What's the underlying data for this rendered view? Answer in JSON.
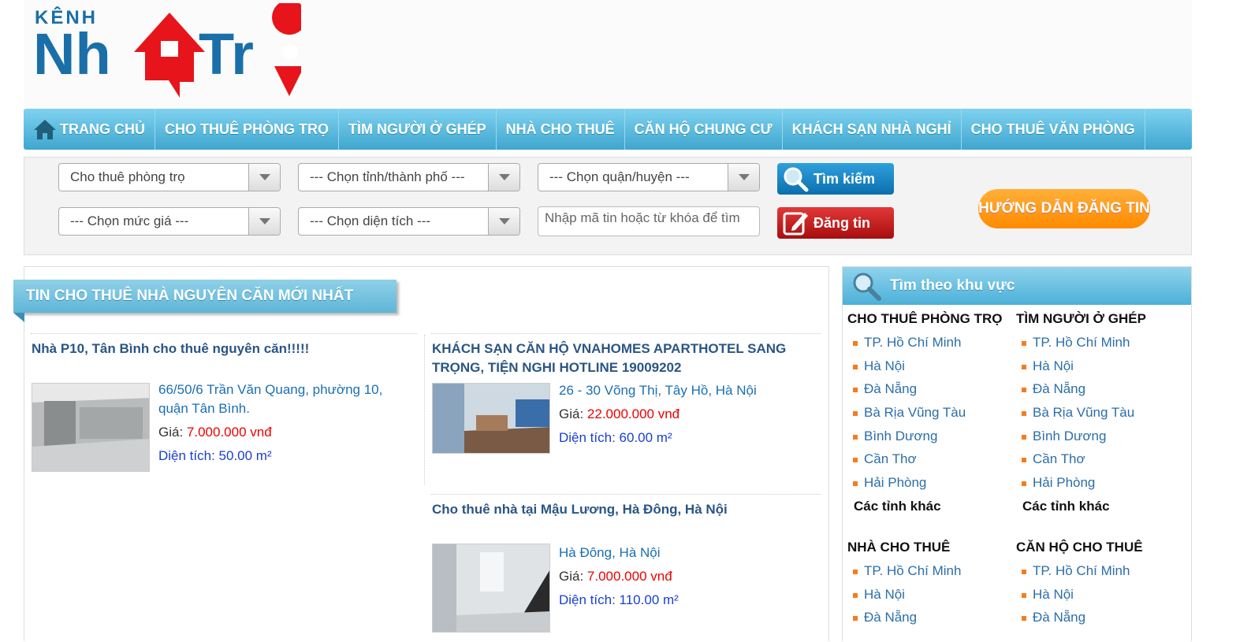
{
  "logo": {
    "top_text": "KÊNH",
    "main_text": "Nhà Trọ"
  },
  "nav": {
    "home": "TRANG CHỦ",
    "items": [
      "CHO THUÊ PHÒNG TRỌ",
      "TÌM NGƯỜI Ở GHÉP",
      "NHÀ CHO THUÊ",
      "CĂN HỘ CHUNG CƯ",
      "KHÁCH SẠN NHÀ NGHỈ",
      "CHO THUÊ VĂN PHÒNG"
    ]
  },
  "search": {
    "category": "Cho thuê phòng trọ",
    "province": "--- Chọn tỉnh/thành phố ---",
    "district": "--- Chọn quận/huyện ---",
    "price": "--- Chọn mức giá ---",
    "area": "--- Chọn diện tích ---",
    "keyword_placeholder": "Nhập mã tin hoặc từ khóa để tìm",
    "search_btn": "Tìm kiếm",
    "post_btn": "Đăng tin",
    "guide_btn": "HƯỚNG DẪN ĐĂNG TIN"
  },
  "main": {
    "section_title": "TIN CHO THUÊ NHÀ NGUYÊN CĂN MỚI NHẤT",
    "listings": [
      {
        "title": "Nhà P10, Tân Bình cho thuê nguyên căn!!!!!",
        "address": "66/50/6 Trần Văn Quang, phường 10, quận Tân Bình.",
        "price_label": "Giá:",
        "price": "7.000.000 vnđ",
        "area": "Diện tích: 50.00 m²"
      },
      {
        "title": "KHÁCH SẠN CĂN HỘ VNAHOMES APARTHOTEL SANG TRỌNG, TIỆN NGHI HOTLINE 19009202",
        "address": "26 - 30 Võng Thị, Tây Hồ, Hà Nội",
        "price_label": "Giá:",
        "price": "22.000.000 vnđ",
        "area": "Diện tích: 60.00 m²"
      },
      {
        "title": "Cho thuê nhà tại Mậu Lương, Hà Đông, Hà Nội",
        "address": "Hà Đông, Hà Nội",
        "price_label": "Giá:",
        "price": "7.000.000 vnđ",
        "area": "Diện tích: 110.00 m²"
      }
    ]
  },
  "sidebar": {
    "title": "Tìm theo khu vực",
    "groups": [
      {
        "heading": "CHO THUÊ PHÒNG TRỌ",
        "items": [
          "TP. Hồ Chí Minh",
          "Hà Nội",
          "Đà Nẵng",
          "Bà Rịa Vũng Tàu",
          "Bình Dương",
          "Cần Thơ",
          "Hải Phòng"
        ],
        "more": "Các tỉnh khác"
      },
      {
        "heading": "TÌM NGƯỜI Ở GHÉP",
        "items": [
          "TP. Hồ Chí Minh",
          "Hà Nội",
          "Đà Nẵng",
          "Bà Rịa Vũng Tàu",
          "Bình Dương",
          "Cần Thơ",
          "Hải Phòng"
        ],
        "more": "Các tỉnh khác"
      },
      {
        "heading": "NHÀ CHO THUÊ",
        "items": [
          "TP. Hồ Chí Minh",
          "Hà Nội",
          "Đà Nẵng"
        ]
      },
      {
        "heading": "CĂN HỘ CHO THUÊ",
        "items": [
          "TP. Hồ Chí Minh",
          "Hà Nội",
          "Đà Nẵng"
        ]
      }
    ]
  },
  "colors": {
    "nav": "#4cb0d8",
    "price": "#e00000",
    "accent_orange": "#ff8a00",
    "post_red": "#c41a1a"
  }
}
